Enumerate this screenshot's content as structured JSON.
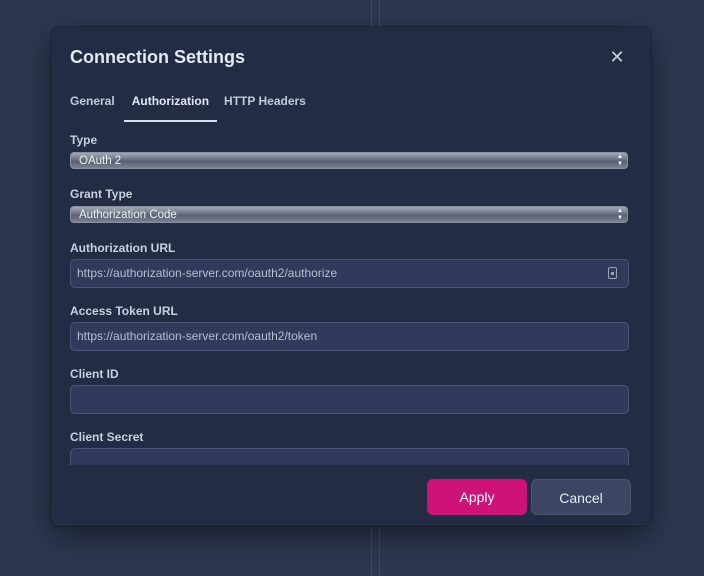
{
  "dialog": {
    "title": "Connection Settings",
    "close_icon": "close-icon"
  },
  "tabs": [
    {
      "label": "General",
      "active": false
    },
    {
      "label": "Authorization",
      "active": true
    },
    {
      "label": "HTTP Headers",
      "active": false
    }
  ],
  "form": {
    "type": {
      "label": "Type",
      "value": "OAuth 2"
    },
    "grant_type": {
      "label": "Grant Type",
      "value": "Authorization Code"
    },
    "authorization_url": {
      "label": "Authorization URL",
      "placeholder": "https://authorization-server.com/oauth2/authorize",
      "icon": "keychain-icon"
    },
    "access_token_url": {
      "label": "Access Token URL",
      "placeholder": "https://authorization-server.com/oauth2/token"
    },
    "client_id": {
      "label": "Client ID",
      "value": ""
    },
    "client_secret": {
      "label": "Client Secret",
      "value": ""
    }
  },
  "footer": {
    "apply_label": "Apply",
    "cancel_label": "Cancel"
  },
  "colors": {
    "background": "#2d3750",
    "dialog": "#222c45",
    "input": "#303b5c",
    "accent": "#cf1277"
  }
}
